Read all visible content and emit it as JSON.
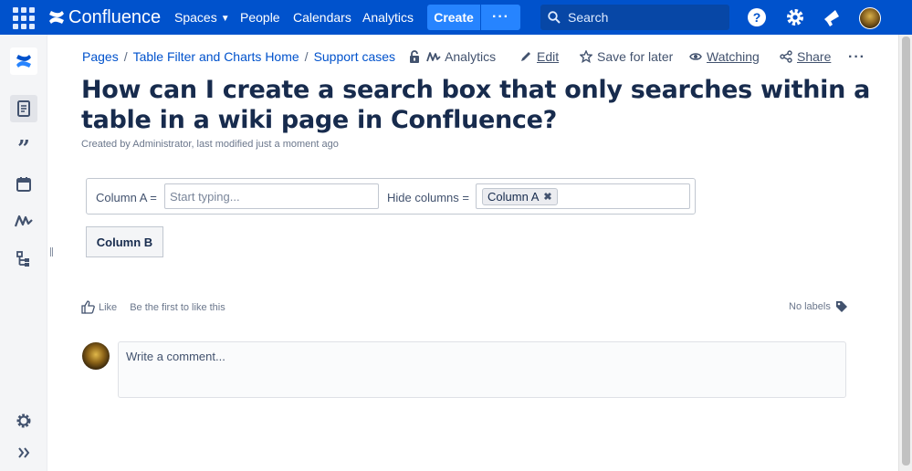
{
  "nav": {
    "logo": "Confluence",
    "spaces": "Spaces",
    "people": "People",
    "calendars": "Calendars",
    "analytics": "Analytics",
    "create": "Create",
    "more": "···",
    "search_placeholder": "Search"
  },
  "breadcrumb": {
    "items": [
      "Pages",
      "Table Filter and Charts Home",
      "Support cases"
    ],
    "analytics": "Analytics"
  },
  "actions": {
    "edit": "Edit",
    "save_for_later": "Save for later",
    "watching": "Watching",
    "share": "Share",
    "more": "···"
  },
  "page": {
    "title": "How can I create a search box that only searches within a table in a wiki page in Confluence?",
    "byline": "Created by Administrator, last modified just a moment ago"
  },
  "filter": {
    "column_a_label": "Column A =",
    "column_a_placeholder": "Start typing...",
    "hide_columns_label": "Hide columns =",
    "hidden_tag": "Column A",
    "tag_remove": "✖"
  },
  "table": {
    "header": "Column B"
  },
  "footer": {
    "like": "Like",
    "like_text": "Be the first to like this",
    "no_labels": "No labels",
    "comment_placeholder": "Write a comment..."
  },
  "colors": {
    "nav_bg": "#0052cc",
    "create_bg": "#2684ff",
    "link": "#0052cc"
  }
}
